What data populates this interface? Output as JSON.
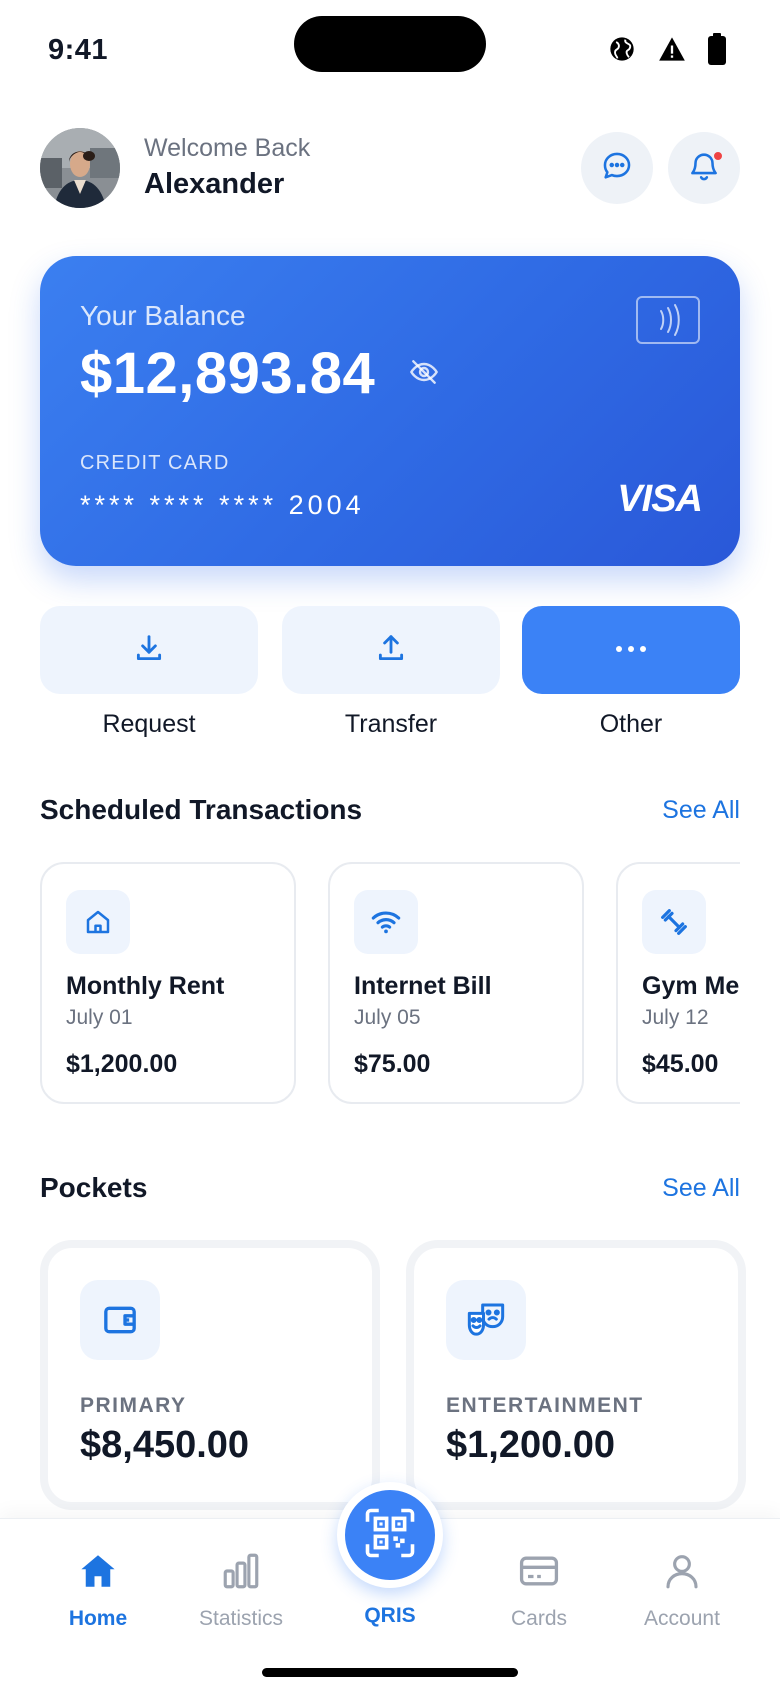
{
  "status_bar": {
    "time": "9:41"
  },
  "header": {
    "welcome": "Welcome Back",
    "username": "Alexander"
  },
  "balance_card": {
    "label": "Your Balance",
    "amount": "$12,893.84",
    "card_type_label": "CREDIT CARD",
    "card_number": "**** **** **** 2004",
    "network": "VISA",
    "gradient_start": "#3b7ff0",
    "gradient_end": "#2a58d8"
  },
  "actions": [
    {
      "label": "Request",
      "icon": "download-icon"
    },
    {
      "label": "Transfer",
      "icon": "upload-icon"
    },
    {
      "label": "Other",
      "icon": "more-dots-icon"
    }
  ],
  "scheduled": {
    "title": "Scheduled Transactions",
    "see_all": "See All",
    "items": [
      {
        "name": "Monthly Rent",
        "date": "July 01",
        "amount": "$1,200.00",
        "icon": "home-icon"
      },
      {
        "name": "Internet Bill",
        "date": "July 05",
        "amount": "$75.00",
        "icon": "wifi-icon"
      },
      {
        "name": "Gym Membership",
        "date": "July 12",
        "amount": "$45.00",
        "icon": "dumbbell-icon"
      }
    ]
  },
  "pockets": {
    "title": "Pockets",
    "see_all": "See All",
    "items": [
      {
        "label": "PRIMARY",
        "amount": "$8,450.00",
        "icon": "wallet-icon"
      },
      {
        "label": "ENTERTAINMENT",
        "amount": "$1,200.00",
        "icon": "theater-masks-icon"
      }
    ]
  },
  "bottom_nav": {
    "items": [
      {
        "label": "Home",
        "icon": "home-icon",
        "active": true
      },
      {
        "label": "Statistics",
        "icon": "bar-chart-icon",
        "active": false
      },
      {
        "label": "QRIS",
        "icon": "qr-code-icon",
        "active": false
      },
      {
        "label": "Cards",
        "icon": "credit-card-icon",
        "active": false
      },
      {
        "label": "Account",
        "icon": "user-icon",
        "active": false
      }
    ]
  },
  "colors": {
    "accent": "#1d74e0",
    "primary_button": "#3b82f6",
    "light_tint": "#eef4fd",
    "notification": "#ef4444"
  }
}
